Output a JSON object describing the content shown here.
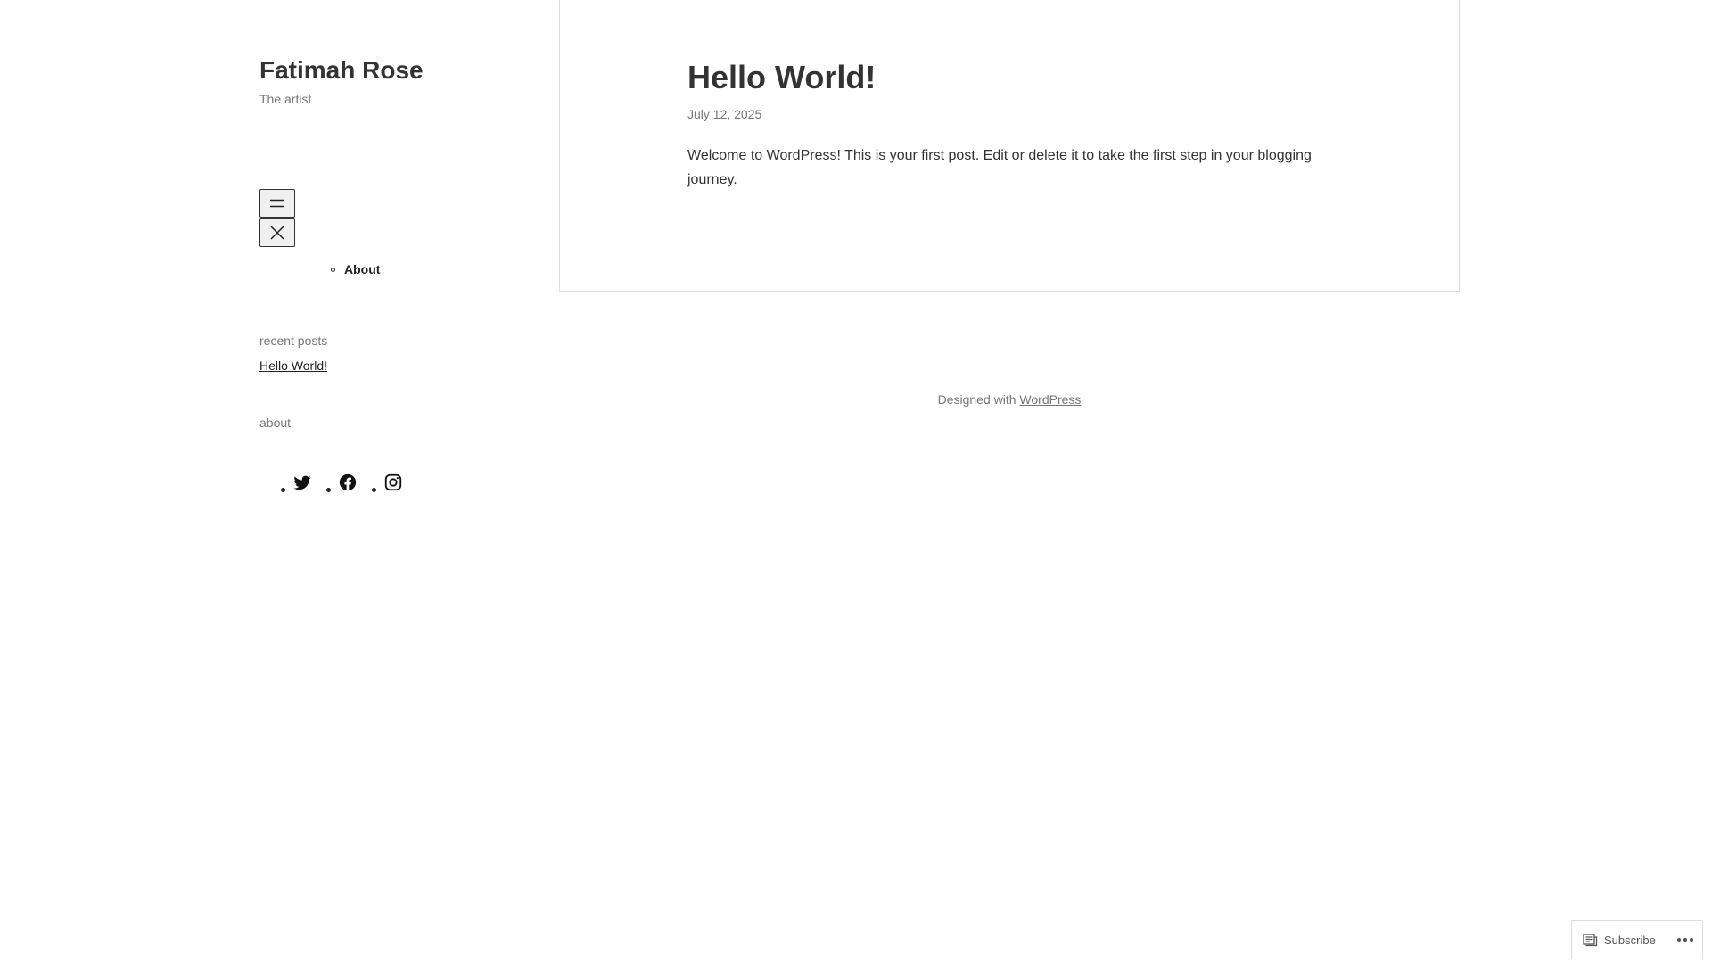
{
  "site": {
    "title": "Fatimah Rose",
    "tagline": "The artist"
  },
  "nav": {
    "open_icon": "hamburger-menu-icon",
    "close_icon": "close-icon",
    "items": [
      {
        "label": "About"
      }
    ]
  },
  "widgets": {
    "recent_posts_title": "recent posts",
    "recent_posts": [
      {
        "label": "Hello World!"
      }
    ],
    "about_title": "about",
    "social_icons": [
      "twitter-icon",
      "facebook-icon",
      "instagram-icon"
    ]
  },
  "post": {
    "title": "Hello World!",
    "date": "July 12, 2025",
    "body": "Welcome to WordPress! This is your first post. Edit or delete it to take the first step in your blogging journey."
  },
  "footer": {
    "prefix": "Designed with",
    "link": "WordPress"
  },
  "subscribe": {
    "label": "Subscribe",
    "icon": "reader-icon",
    "more_icon": "ellipsis-icon"
  },
  "colors": {
    "text": "#333333",
    "muted": "#767676",
    "border": "#dddddd"
  }
}
